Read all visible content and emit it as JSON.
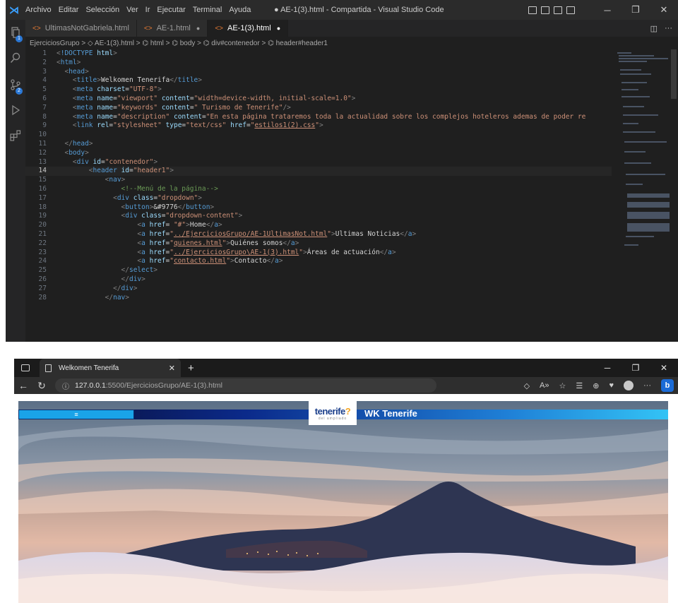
{
  "vscode": {
    "menu": [
      "Archivo",
      "Editar",
      "Selección",
      "Ver",
      "Ir",
      "Ejecutar",
      "Terminal",
      "Ayuda"
    ],
    "window_title": "● AE-1(3).html - Compartida - Visual Studio Code",
    "source_control_badge": "2",
    "tabs": [
      {
        "label": "UltimasNotGabriela.html",
        "modified": ""
      },
      {
        "label": "AE-1.html",
        "modified": "●"
      },
      {
        "label": "AE-1(3).html",
        "modified": "●"
      }
    ],
    "breadcrumb": "EjerciciosGrupo > ◇ AE-1(3).html > ⌬ html > ⌬ body > ⌬ div#contenedor > ⌬ header#header1",
    "current_line": 14
  },
  "browser": {
    "tab_title": "Welkomen Tenerifa",
    "url_host": "127.0.0.1",
    "url_path": ":5500/EjerciciosGrupo/AE-1(3).html",
    "page": {
      "menu_button": "≡",
      "logo_word_a": "te",
      "logo_word_b": "nerife",
      "logo_sub": "del ampliado",
      "site_title": "WK Tenerife"
    }
  },
  "colors": {
    "tag": "#569cd6",
    "attr": "#9cdcfe",
    "string": "#ce9178",
    "comment": "#6a9955",
    "accent": "#2b78d6"
  }
}
